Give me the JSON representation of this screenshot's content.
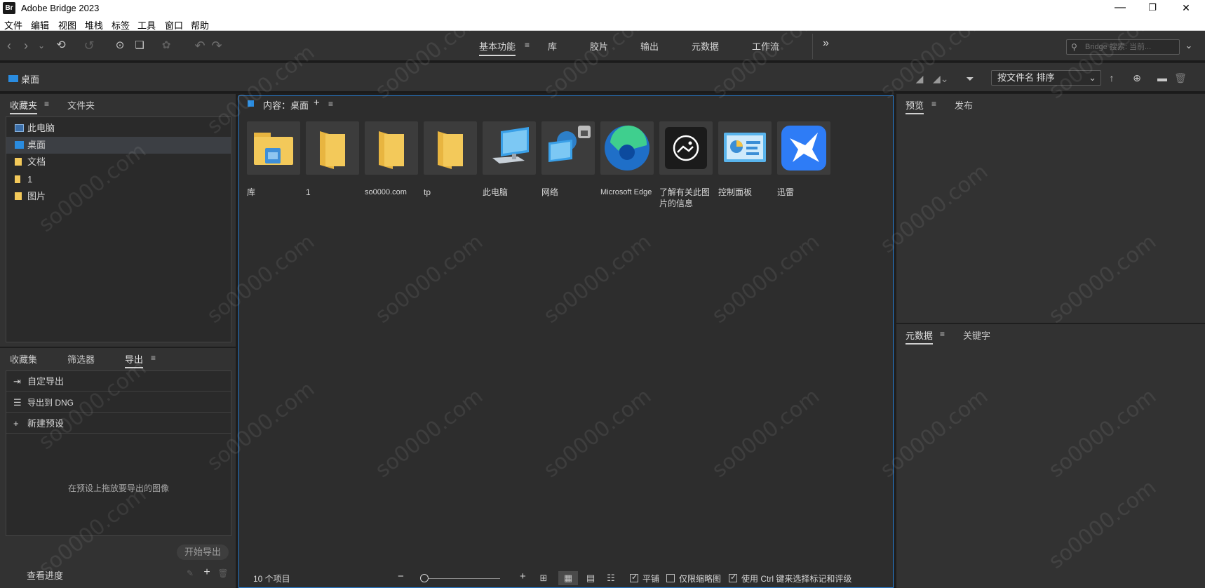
{
  "window": {
    "app_icon": "Br",
    "title": "Adobe Bridge 2023",
    "minimize": "—",
    "maximize": "❐",
    "close": "✕"
  },
  "menu": [
    "文件",
    "编辑",
    "视图",
    "堆栈",
    "标签",
    "工具",
    "窗口",
    "帮助"
  ],
  "workspaces": {
    "items": [
      "基本功能",
      "库",
      "胶片",
      "输出",
      "元数据",
      "工作流"
    ],
    "active": "基本功能",
    "more": "»"
  },
  "search": {
    "placeholder": "Bridge 搜索: 当前..."
  },
  "path": {
    "current": "桌面"
  },
  "sort": {
    "label": "按文件名 排序"
  },
  "left_top_panel": {
    "tabs": [
      "收藏夹",
      "文件夹"
    ],
    "active": "收藏夹",
    "items": [
      {
        "label": "此电脑",
        "icon": "computer-icon"
      },
      {
        "label": "桌面",
        "icon": "desktop-icon",
        "selected": true
      },
      {
        "label": "文档",
        "icon": "document-icon"
      },
      {
        "label": "1",
        "icon": "folder-icon"
      },
      {
        "label": "图片",
        "icon": "pictures-icon"
      }
    ]
  },
  "left_bottom_panel": {
    "tabs": [
      "收藏集",
      "筛选器",
      "导出"
    ],
    "active": "导出",
    "items": [
      {
        "label": "自定导出",
        "icon": "export-icon"
      },
      {
        "label": "导出到 DNG",
        "icon": "list-icon"
      },
      {
        "label": "新建预设",
        "icon": "plus-icon"
      }
    ],
    "drop_hint": "在预设上拖放要导出的图像",
    "start_button": "开始导出",
    "progress_label": "查看进度"
  },
  "content": {
    "title": "内容：桌面",
    "add": "+",
    "items": [
      {
        "label": "库",
        "icon": "library-folder-icon"
      },
      {
        "label": "1",
        "icon": "folder-icon"
      },
      {
        "label": "so0000.com",
        "icon": "folder-icon"
      },
      {
        "label": "tp",
        "icon": "folder-icon"
      },
      {
        "label": "此电脑",
        "icon": "computer-icon"
      },
      {
        "label": "网络",
        "icon": "network-icon"
      },
      {
        "label": "Microsoft Edge",
        "icon": "edge-icon"
      },
      {
        "label": "了解有关此图片的信息",
        "icon": "info-image-icon"
      },
      {
        "label": "控制面板",
        "icon": "control-panel-icon"
      },
      {
        "label": "迅雷",
        "icon": "thunder-icon"
      }
    ],
    "item_count": "10 个项目",
    "tile_label": "平铺",
    "thumbs_only_label": "仅限缩略图",
    "ctrl_label": "使用 Ctrl 键来选择标记和评级"
  },
  "right_top_panel": {
    "tabs": [
      "预览",
      "发布"
    ],
    "active": "预览"
  },
  "right_bottom_panel": {
    "tabs": [
      "元数据",
      "关键字"
    ],
    "active": "元数据"
  },
  "watermark": "so0000.com",
  "colors": {
    "accent": "#2a7fd4",
    "panel_bg": "#323232",
    "content_bg": "#2d2d2d",
    "folder_yellow": "#f3c95a"
  }
}
